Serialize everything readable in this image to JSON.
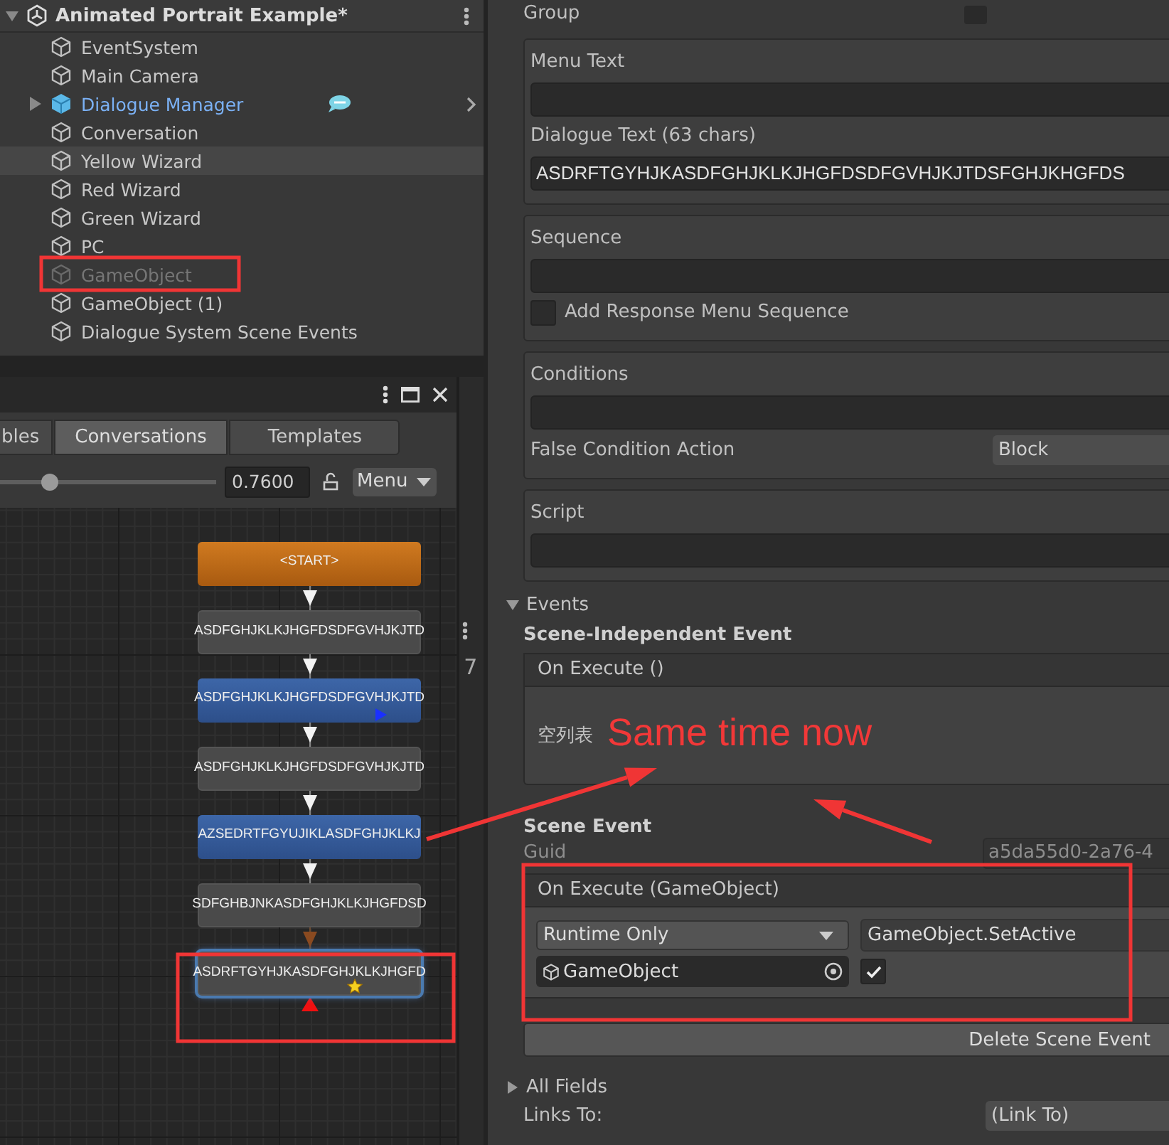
{
  "hierarchy": {
    "scene": "Animated Portrait Example*",
    "items": [
      {
        "label": "EventSystem",
        "kind": "object",
        "selected": false,
        "disabled": false,
        "expandable": false
      },
      {
        "label": "Main Camera",
        "kind": "object",
        "selected": false,
        "disabled": false,
        "expandable": false
      },
      {
        "label": "Dialogue Manager",
        "kind": "prefab",
        "selected": false,
        "disabled": false,
        "expandable": true
      },
      {
        "label": "Conversation",
        "kind": "object",
        "selected": false,
        "disabled": false,
        "expandable": false
      },
      {
        "label": "Yellow Wizard",
        "kind": "object",
        "selected": true,
        "disabled": false,
        "expandable": false
      },
      {
        "label": "Red Wizard",
        "kind": "object",
        "selected": false,
        "disabled": false,
        "expandable": false
      },
      {
        "label": "Green Wizard",
        "kind": "object",
        "selected": false,
        "disabled": false,
        "expandable": false
      },
      {
        "label": "PC",
        "kind": "object",
        "selected": false,
        "disabled": false,
        "expandable": false
      },
      {
        "label": "GameObject",
        "kind": "object",
        "selected": false,
        "disabled": true,
        "expandable": false
      },
      {
        "label": "GameObject (1)",
        "kind": "object",
        "selected": false,
        "disabled": false,
        "expandable": false
      },
      {
        "label": "Dialogue System Scene Events",
        "kind": "object",
        "selected": false,
        "disabled": false,
        "expandable": false
      }
    ]
  },
  "editor": {
    "tabs": [
      {
        "label": "bles",
        "selected": false
      },
      {
        "label": "Conversations",
        "selected": true
      },
      {
        "label": "Templates",
        "selected": false
      }
    ],
    "zoom": {
      "level": 0.23,
      "value": "0.7600"
    },
    "menu": "Menu",
    "nodes": [
      {
        "text": "<START>",
        "kind": "start",
        "selected": false,
        "starred": false,
        "marked": false
      },
      {
        "text": "ASDFGHJKLKJHGFDSDFGVHJKJTD",
        "kind": "npc",
        "selected": false,
        "starred": false,
        "marked": false
      },
      {
        "text": "ASDFGHJKLKJHGFDSDFGVHJKJTD",
        "kind": "pc",
        "selected": false,
        "starred": false,
        "marked": true
      },
      {
        "text": "ASDFGHJKLKJHGFDSDFGVHJKJTD",
        "kind": "npc",
        "selected": false,
        "starred": false,
        "marked": false
      },
      {
        "text": "AZSEDRTFGYUJIKLASDFGHJKLKJ",
        "kind": "pc",
        "selected": false,
        "starred": false,
        "marked": false
      },
      {
        "text": "SDFGHBJNKASDFGHJKLKJHGFDSD",
        "kind": "npc",
        "selected": false,
        "starred": false,
        "marked": false
      },
      {
        "text": "ASDRFTGYHJKASDFGHJKLKJHGFD",
        "kind": "npc",
        "selected": true,
        "starred": true,
        "marked": false
      }
    ],
    "links": [
      {
        "dimmed": false
      },
      {
        "dimmed": false
      },
      {
        "dimmed": false
      },
      {
        "dimmed": false
      },
      {
        "dimmed": false
      },
      {
        "dimmed": true
      }
    ]
  },
  "side_strip": {
    "text": "7"
  },
  "inspector": {
    "group_label": "Group",
    "group_checked": false,
    "menu_text_label": "Menu Text",
    "dialogue_text_label": "Dialogue Text (63 chars)",
    "dialogue_text": "ASDRFTGYHJKASDFGHJKLKJHGFDSDFGVHJKJTDSFGHJKHGFDS",
    "sequence_label": "Sequence",
    "add_response": {
      "label": "Add Response Menu Sequence",
      "checked": false
    },
    "conditions_label": "Conditions",
    "false_condition": {
      "label": "False Condition Action",
      "value": "Block"
    },
    "script_label": "Script",
    "events": {
      "label": "Events",
      "expanded": true
    },
    "scene_independent": {
      "title": "Scene-Independent Event",
      "header": "On Execute ()",
      "empty_text": "空列表"
    },
    "scene_event": {
      "title": "Scene Event",
      "guid_label": "Guid",
      "guid": "a5da55d0-2a76-4",
      "header": "On Execute (GameObject)",
      "mode": "Runtime Only",
      "function": "GameObject.SetActive",
      "target": "GameObject",
      "arg_checked": true
    },
    "delete_button": "Delete Scene Event",
    "all_fields": {
      "label": "All Fields",
      "expanded": false
    },
    "links_to": {
      "label": "Links To:",
      "value": "(Link To)"
    }
  },
  "annotation": {
    "text": "Same time now"
  }
}
